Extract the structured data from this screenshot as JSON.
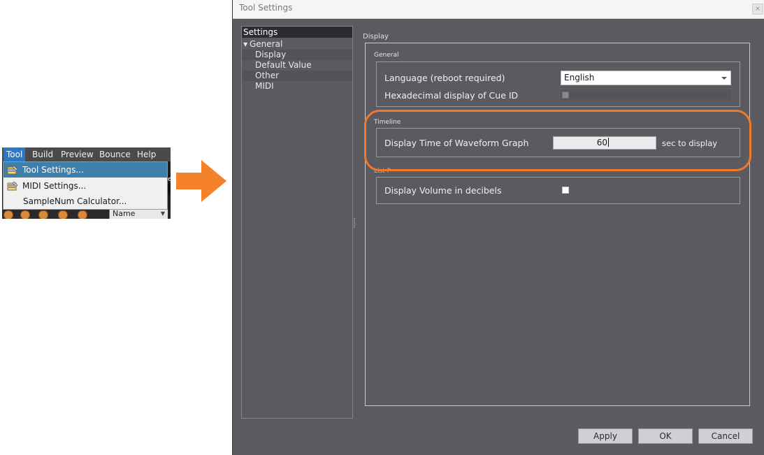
{
  "menu": {
    "bar": [
      "Tool",
      "Build",
      "Preview",
      "Bounce",
      "Help"
    ],
    "active": "Tool",
    "items": [
      {
        "label": "Tool Settings...",
        "icon": "settings-icon",
        "highlighted": true
      },
      {
        "label": "MIDI Settings...",
        "icon": "midi-settings-icon",
        "highlighted": false
      },
      {
        "label": "SampleNum Calculator...",
        "icon": "",
        "highlighted": false
      }
    ],
    "name_column": "Name",
    "side_peek": "e"
  },
  "arrow_color": "#f5822a",
  "dialog": {
    "title": "Tool Settings",
    "close": "×",
    "tree": {
      "header": "Settings",
      "nodes": [
        {
          "label": "General",
          "expanded": true
        },
        {
          "label": "Display"
        },
        {
          "label": "Default Value"
        },
        {
          "label": "Other"
        },
        {
          "label": "MIDI"
        }
      ]
    },
    "content_title": "Display",
    "general": {
      "title": "General",
      "language_label": "Language (reboot required)",
      "language_value": "English",
      "hex_label": "Hexadecimal display of Cue ID"
    },
    "timeline": {
      "title": "Timeline",
      "waveform_label": "Display Time of Waveform Graph",
      "waveform_value": "60",
      "waveform_unit": "sec to display"
    },
    "third": {
      "title_partial": "List P",
      "volume_label": "Display Volume in decibels"
    },
    "buttons": {
      "apply": "Apply",
      "ok": "OK",
      "cancel": "Cancel"
    },
    "highlight_color": "#f07a2a"
  }
}
